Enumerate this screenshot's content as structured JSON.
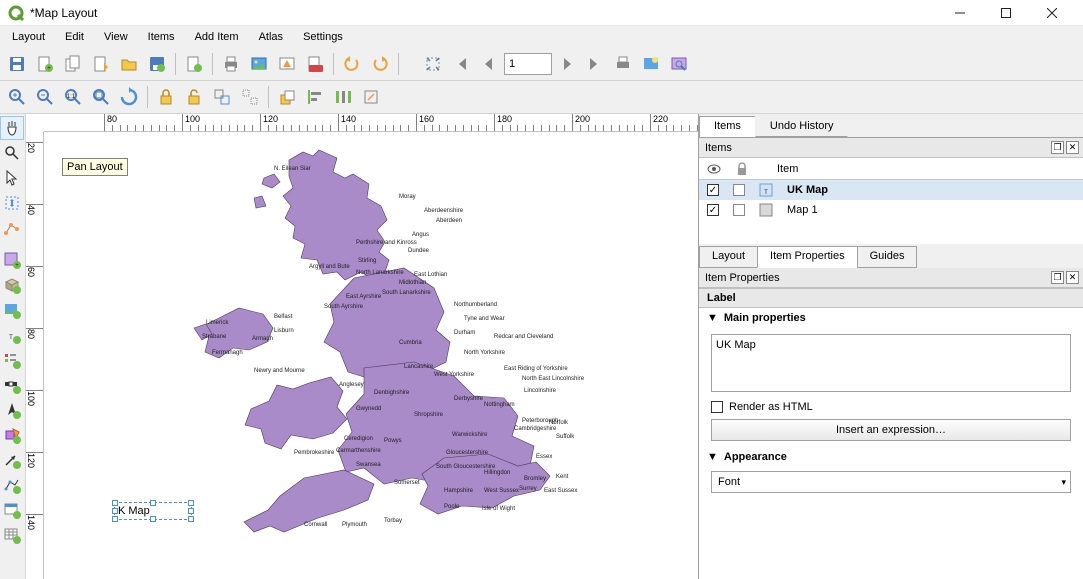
{
  "window": {
    "title": "*Map Layout"
  },
  "menu": [
    "Layout",
    "Edit",
    "View",
    "Items",
    "Add Item",
    "Atlas",
    "Settings"
  ],
  "toolbar2_page": "1",
  "tooltip": "Pan Layout",
  "hruler": [
    "80",
    "100",
    "120",
    "140",
    "160",
    "180",
    "200",
    "220"
  ],
  "vruler": [
    "20",
    "40",
    "60",
    "80",
    "100",
    "120",
    "140"
  ],
  "canvas_label": "K  Map",
  "right": {
    "tabs_top": [
      "Items",
      "Undo History"
    ],
    "items_panel_title": "Items",
    "items_header": "Item",
    "items": [
      {
        "checked": true,
        "locked": false,
        "name": "UK Map",
        "bold": true
      },
      {
        "checked": true,
        "locked": false,
        "name": "Map 1",
        "bold": false
      }
    ],
    "tabs_mid": [
      "Layout",
      "Item Properties",
      "Guides"
    ],
    "prop_panel_title": "Item Properties",
    "label_section": "Label",
    "main_props": "Main properties",
    "text_value": "UK Map",
    "render_html": "Render as HTML",
    "insert_expr": "Insert an expression…",
    "appearance": "Appearance",
    "font_label": "Font"
  },
  "map_regions": [
    "N. Eilean Siar",
    "Moray",
    "Aberdeenshire",
    "Aberdeen",
    "Perthshire and Kinross",
    "Angus",
    "Dundee",
    "Stirling",
    "Argyll and Bute",
    "North Lanarkshire",
    "East Lothian",
    "Midlothian",
    "South Lanarkshire",
    "East Ayrshire",
    "South Ayrshire",
    "Northumberland",
    "Tyne and Wear",
    "Cumbria",
    "Durham",
    "Redcar and Cleveland",
    "North Yorkshire",
    "Lancashire",
    "East Riding of Yorkshire",
    "West Yorkshire",
    "North East Lincolnshire",
    "Lincolnshire",
    "Anglesey",
    "Denbighshire",
    "Gwynedd",
    "Derbyshire",
    "Nottingham",
    "Ceredigion",
    "Powys",
    "Shropshire",
    "Warwickshire",
    "Cambridgeshire",
    "Peterborough",
    "Norfolk",
    "Suffolk",
    "Pembrokeshire",
    "Carmarthenshire",
    "Swansea",
    "Gloucestershire",
    "Essex",
    "Somerset",
    "South Gloucestershire",
    "Hillingdon",
    "Bromley",
    "Kent",
    "Hampshire",
    "West Sussex",
    "Surrey",
    "East Sussex",
    "Poole",
    "Isle of Wight",
    "Cornwall",
    "Plymouth",
    "Torbay",
    "Limerick",
    "Strabane",
    "Fermanagh",
    "Armagh",
    "Lisburn",
    "Belfast",
    "Newry and Mourne"
  ]
}
